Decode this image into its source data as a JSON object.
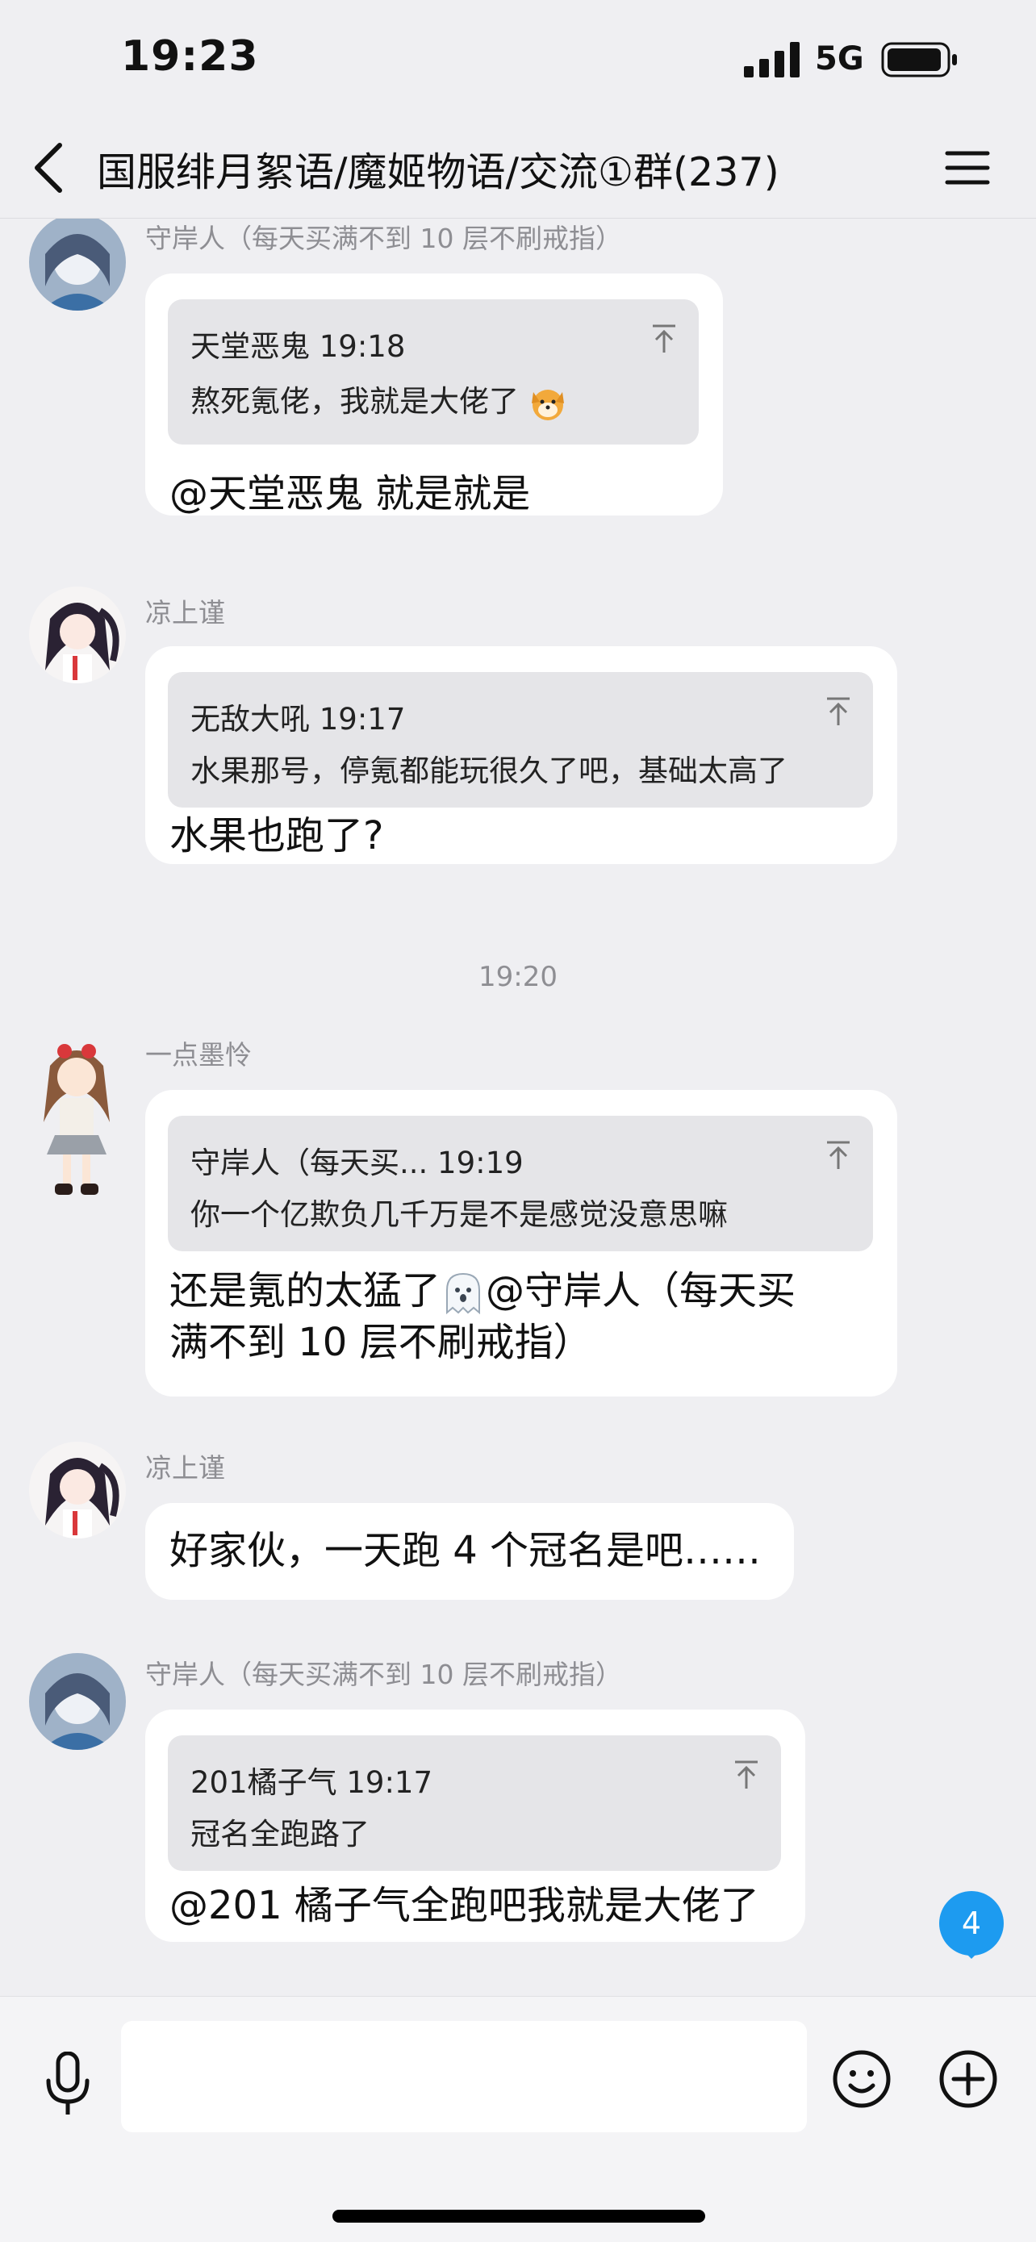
{
  "status_bar": {
    "time": "19:23",
    "network": "5G",
    "battery_percent": 88
  },
  "header": {
    "title": "国服绯月絮语/魔姬物语/交流①群(237)"
  },
  "messages": [
    {
      "sender": "守岸人（每天买满不到 10 层不刷戒指）",
      "reply": {
        "meta": "天堂恶鬼 19:18",
        "text": "熬死氪佬，我就是大佬了"
      },
      "text": "@天堂恶鬼 就是就是"
    },
    {
      "sender": "凉上谨",
      "reply": {
        "meta": "无敌大吼 19:17",
        "text": "水果那号，停氪都能玩很久了吧，基础太高了"
      },
      "text": "水果也跑了?"
    },
    {
      "sender": "一点墨怜",
      "reply": {
        "meta": "守岸人（每天买... 19:19",
        "text": "你一个亿欺负几千万是不是感觉没意思嘛"
      },
      "text_line1_a": "还是氪的太猛了",
      "text_line1_b": "@守岸人（每天买",
      "text_line2": "满不到 10 层不刷戒指）"
    },
    {
      "sender": "凉上谨",
      "text": "好家伙，一天跑 4 个冠名是吧……"
    },
    {
      "sender": "守岸人（每天买满不到 10 层不刷戒指）",
      "reply": {
        "meta": "201橘子气 19:17",
        "text": "冠名全跑路了"
      },
      "text": "@201 橘子气全跑吧我就是大佬了"
    }
  ],
  "timestamp_divider": "19:20",
  "unread_count": "4",
  "input": {
    "placeholder": ""
  },
  "colors": {
    "badge": "#1d9bf0",
    "bubble": "#ffffff",
    "quote": "#e5e5e8",
    "background": "#efeff2"
  }
}
